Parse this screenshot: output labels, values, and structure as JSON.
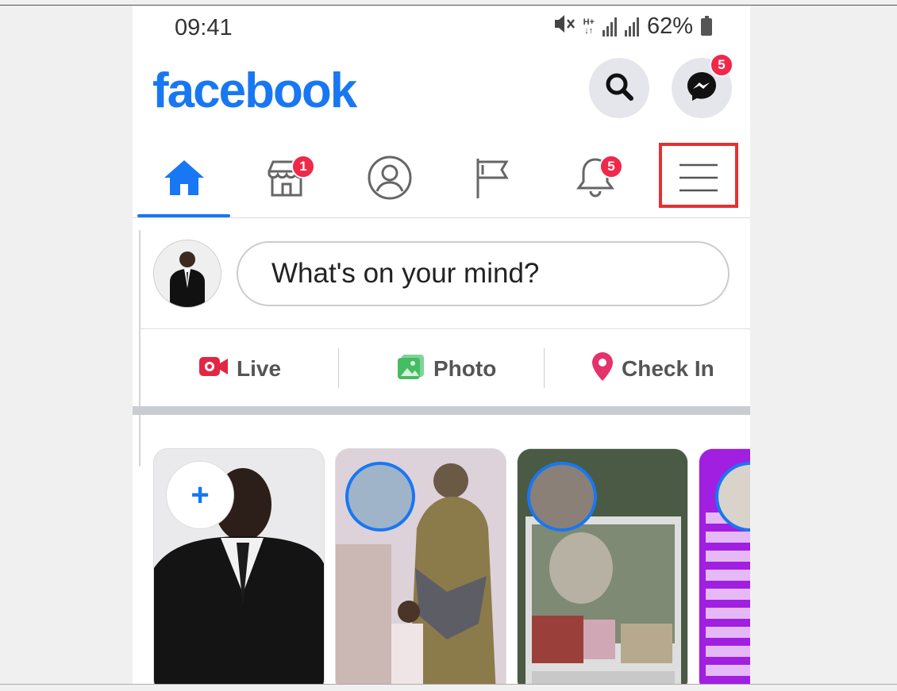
{
  "status_bar": {
    "time": "09:41",
    "network_top": "H+",
    "battery_percent": "62%",
    "icons": [
      "mute-icon",
      "data-arrows-icon",
      "signal-icon",
      "roaming-signal-icon",
      "battery-icon"
    ]
  },
  "header": {
    "logo_text": "facebook",
    "search_icon": "search-icon",
    "messenger_icon": "messenger-icon",
    "messenger_badge": "5"
  },
  "nav": {
    "items": [
      {
        "icon": "home-icon",
        "active": true
      },
      {
        "icon": "marketplace-icon",
        "badge": "1"
      },
      {
        "icon": "profile-icon"
      },
      {
        "icon": "pages-flag-icon"
      },
      {
        "icon": "notifications-bell-icon",
        "badge": "5"
      },
      {
        "icon": "menu-icon",
        "highlighted": true
      }
    ]
  },
  "composer": {
    "placeholder": "What's on your mind?"
  },
  "actions": {
    "live": "Live",
    "photo": "Photo",
    "checkin": "Check In"
  },
  "stories": {
    "add_symbol": "+",
    "count_visible": 4
  },
  "colors": {
    "brand": "#1877f2",
    "badge": "#f02849",
    "highlight": "#e63030",
    "live": "#e42645",
    "photo": "#45bd62",
    "checkin": "#e4326b"
  }
}
